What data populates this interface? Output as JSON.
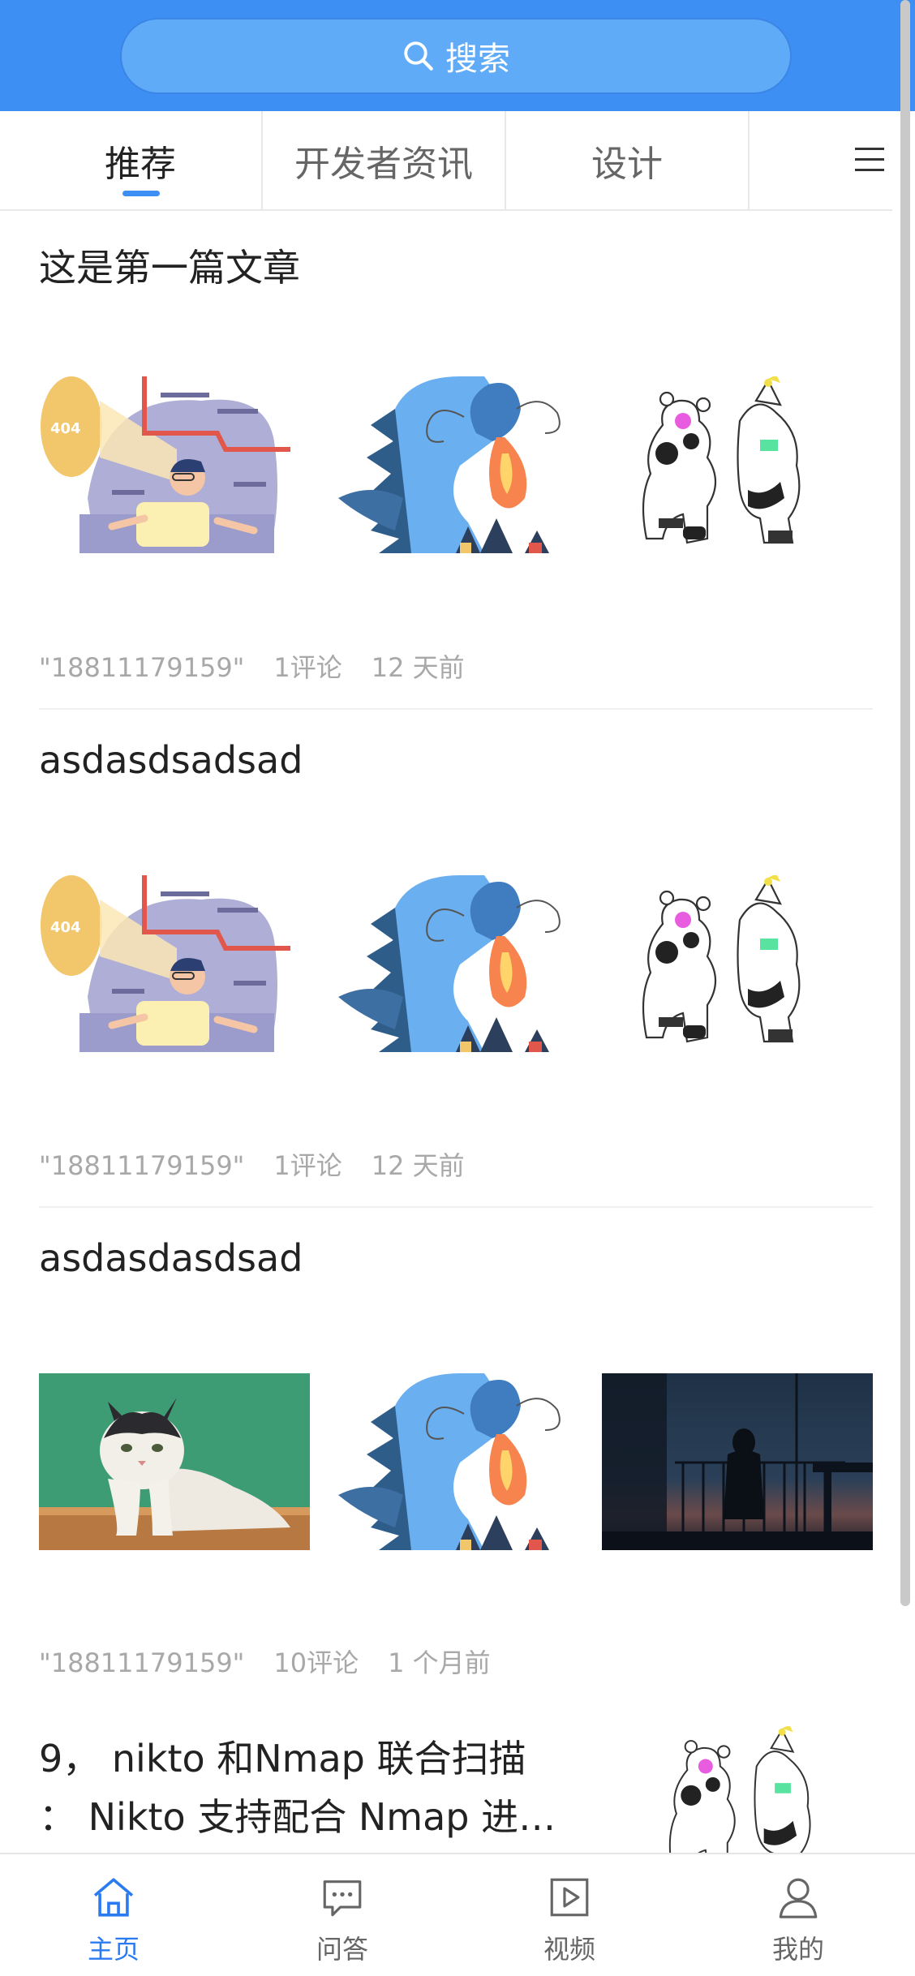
{
  "search": {
    "label": "搜索"
  },
  "tabs": [
    {
      "label": "推荐",
      "active": true
    },
    {
      "label": "开发者资讯"
    },
    {
      "label": "设计"
    }
  ],
  "articles": [
    {
      "title": "这是第一篇文章",
      "author": "\"18811179159\"",
      "comments": "1评论",
      "time": "12 天前",
      "images": [
        "404-illustration",
        "dragon-illustration",
        "clowns-illustration"
      ]
    },
    {
      "title": "asdasdsadsad",
      "author": "\"18811179159\"",
      "comments": "1评论",
      "time": "12 天前",
      "images": [
        "404-illustration",
        "dragon-illustration",
        "clowns-illustration"
      ]
    },
    {
      "title": "asdasdasdsad",
      "author": "\"18811179159\"",
      "comments": "10评论",
      "time": "1 个月前",
      "images": [
        "cat-photo",
        "dragon-illustration",
        "night-balcony-photo"
      ]
    },
    {
      "title_lines": [
        "9， nikto 和Nmap 联合扫描",
        "： Nikto 支持配合 Nmap 进…"
      ],
      "images": [
        "clowns-illustration"
      ]
    }
  ],
  "bottom_nav": [
    {
      "label": "主页",
      "icon": "home-icon",
      "active": true
    },
    {
      "label": "问答",
      "icon": "chat-icon"
    },
    {
      "label": "视频",
      "icon": "video-icon"
    },
    {
      "label": "我的",
      "icon": "user-icon"
    }
  ],
  "colors": {
    "primary": "#3d8ff3",
    "search_bg": "#5fabf8",
    "meta_text": "#a8a8a8"
  }
}
